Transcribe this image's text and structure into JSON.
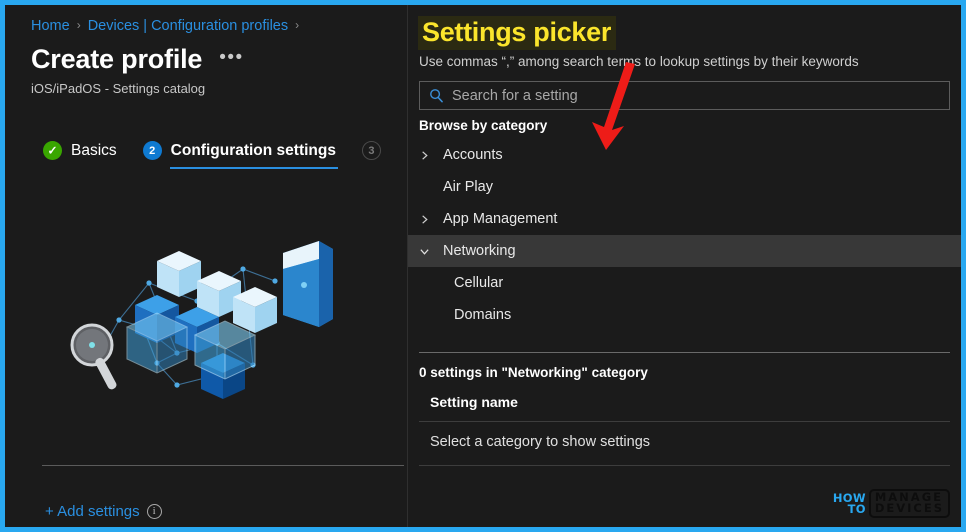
{
  "theme": {
    "accent_blue": "#2a8fe0",
    "border_cyan": "#29a8f0",
    "highlight_yellow": "#fbe52c",
    "annotation_red": "#ee1c18",
    "panel_bg": "#1b1b1b",
    "selected_row_bg": "#383838"
  },
  "left": {
    "breadcrumb": {
      "items": [
        "Home",
        "Devices | Configuration profiles"
      ],
      "separator": "›"
    },
    "page_title": "Create profile",
    "ellipsis_label": "•••",
    "subtitle": "iOS/iPadOS - Settings catalog",
    "tabs": [
      {
        "badge": "✓",
        "badge_state": "done",
        "label": "Basics",
        "active": false
      },
      {
        "badge": "2",
        "badge_state": "current",
        "label": "Configuration settings",
        "active": true
      },
      {
        "badge": "3",
        "badge_state": "pending",
        "label": "",
        "active": false
      }
    ],
    "illustration_name": "settings-catalog-illustration",
    "add_settings_label": "+ Add settings",
    "info_icon_glyph": "i"
  },
  "right": {
    "title": "Settings picker",
    "subtitle": "Use commas “,” among search terms to lookup settings by their keywords",
    "search": {
      "placeholder": "Search for a setting",
      "value": "",
      "icon": "search-icon"
    },
    "browse_label": "Browse by category",
    "tree": [
      {
        "label": "Accounts",
        "level": 0,
        "chevron": "collapsed",
        "selected": false
      },
      {
        "label": "Air Play",
        "level": 0,
        "chevron": "none",
        "selected": false
      },
      {
        "label": "App Management",
        "level": 0,
        "chevron": "collapsed",
        "selected": false
      },
      {
        "label": "Networking",
        "level": 0,
        "chevron": "expanded",
        "selected": true
      },
      {
        "label": "Cellular",
        "level": 1,
        "chevron": "none",
        "selected": false
      },
      {
        "label": "Domains",
        "level": 1,
        "chevron": "none",
        "selected": false
      }
    ],
    "results": {
      "count_label": "0 settings in \"Networking\" category",
      "column_header": "Setting name",
      "empty_message": "Select a category to show settings"
    }
  },
  "watermark": {
    "line1": "HOW",
    "line2": "TO",
    "line3": "MANAGE",
    "line4": "DEVICES"
  }
}
